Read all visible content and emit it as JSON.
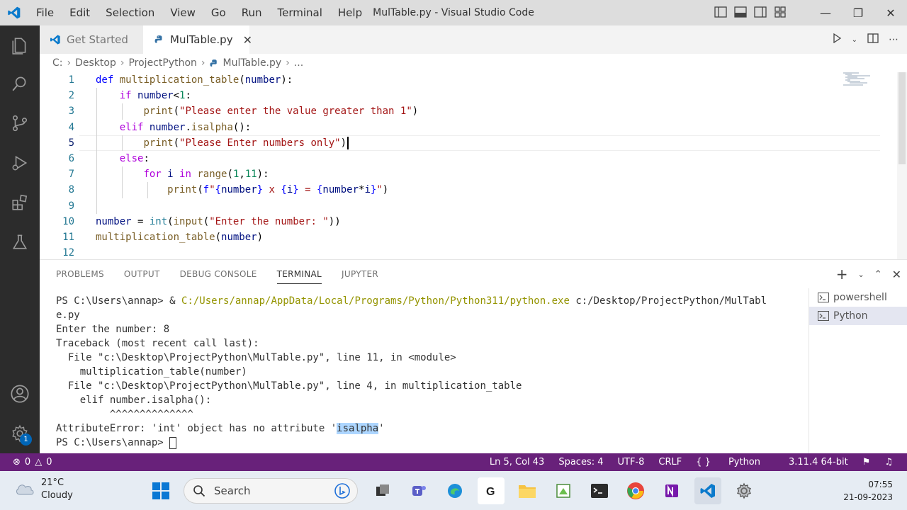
{
  "window": {
    "title": "MulTable.py - Visual Studio Code",
    "menu": [
      "File",
      "Edit",
      "Selection",
      "View",
      "Go",
      "Run",
      "Terminal",
      "Help"
    ]
  },
  "tabs": [
    {
      "label": "Get Started",
      "active": false
    },
    {
      "label": "MulTable.py",
      "active": true
    }
  ],
  "breadcrumb": [
    "C:",
    "Desktop",
    "ProjectPython",
    "MulTable.py",
    "..."
  ],
  "editor": {
    "line_numbers": [
      "1",
      "2",
      "3",
      "4",
      "5",
      "6",
      "7",
      "8",
      "9",
      "10",
      "11",
      "12"
    ],
    "current_line": 5
  },
  "panel": {
    "tabs": [
      "PROBLEMS",
      "OUTPUT",
      "DEBUG CONSOLE",
      "TERMINAL",
      "JUPYTER"
    ],
    "active_tab": "TERMINAL",
    "terminal_lines": {
      "l1_prompt": "PS C:\\Users\\annap> & ",
      "l1_exe": "C:/Users/annap/AppData/Local/Programs/Python/Python311/python.exe",
      "l1_arg": " c:/Desktop/ProjectPython/MulTabl",
      "l2": "e.py",
      "l3": "Enter the number: 8",
      "l4": "Traceback (most recent call last):",
      "l5": "  File \"c:\\Desktop\\ProjectPython\\MulTable.py\", line 11, in <module>",
      "l6": "    multiplication_table(number)",
      "l7": "  File \"c:\\Desktop\\ProjectPython\\MulTable.py\", line 4, in multiplication_table",
      "l8": "    elif number.isalpha():",
      "l9": "         ^^^^^^^^^^^^^^",
      "l10_pre": "AttributeError: 'int' object has no attribute '",
      "l10_hl": "isalpha",
      "l10_post": "'",
      "l11": "PS C:\\Users\\annap> "
    },
    "terminal_list": [
      "powershell",
      "Python"
    ],
    "terminal_selected": "Python"
  },
  "statusbar": {
    "errors": "0",
    "warnings": "0",
    "position": "Ln 5, Col 43",
    "spaces": "Spaces: 4",
    "encoding": "UTF-8",
    "eol": "CRLF",
    "language": "Python",
    "interpreter": "3.11.4 64-bit"
  },
  "activity_badge": "1",
  "taskbar": {
    "temperature": "21°C",
    "condition": "Cloudy",
    "search_placeholder": "Search",
    "time": "07:55",
    "date": "21-09-2023"
  },
  "colors": {
    "statusbar": "#68217a",
    "activitybar": "#2c2c2c",
    "accent": "#007acc"
  }
}
